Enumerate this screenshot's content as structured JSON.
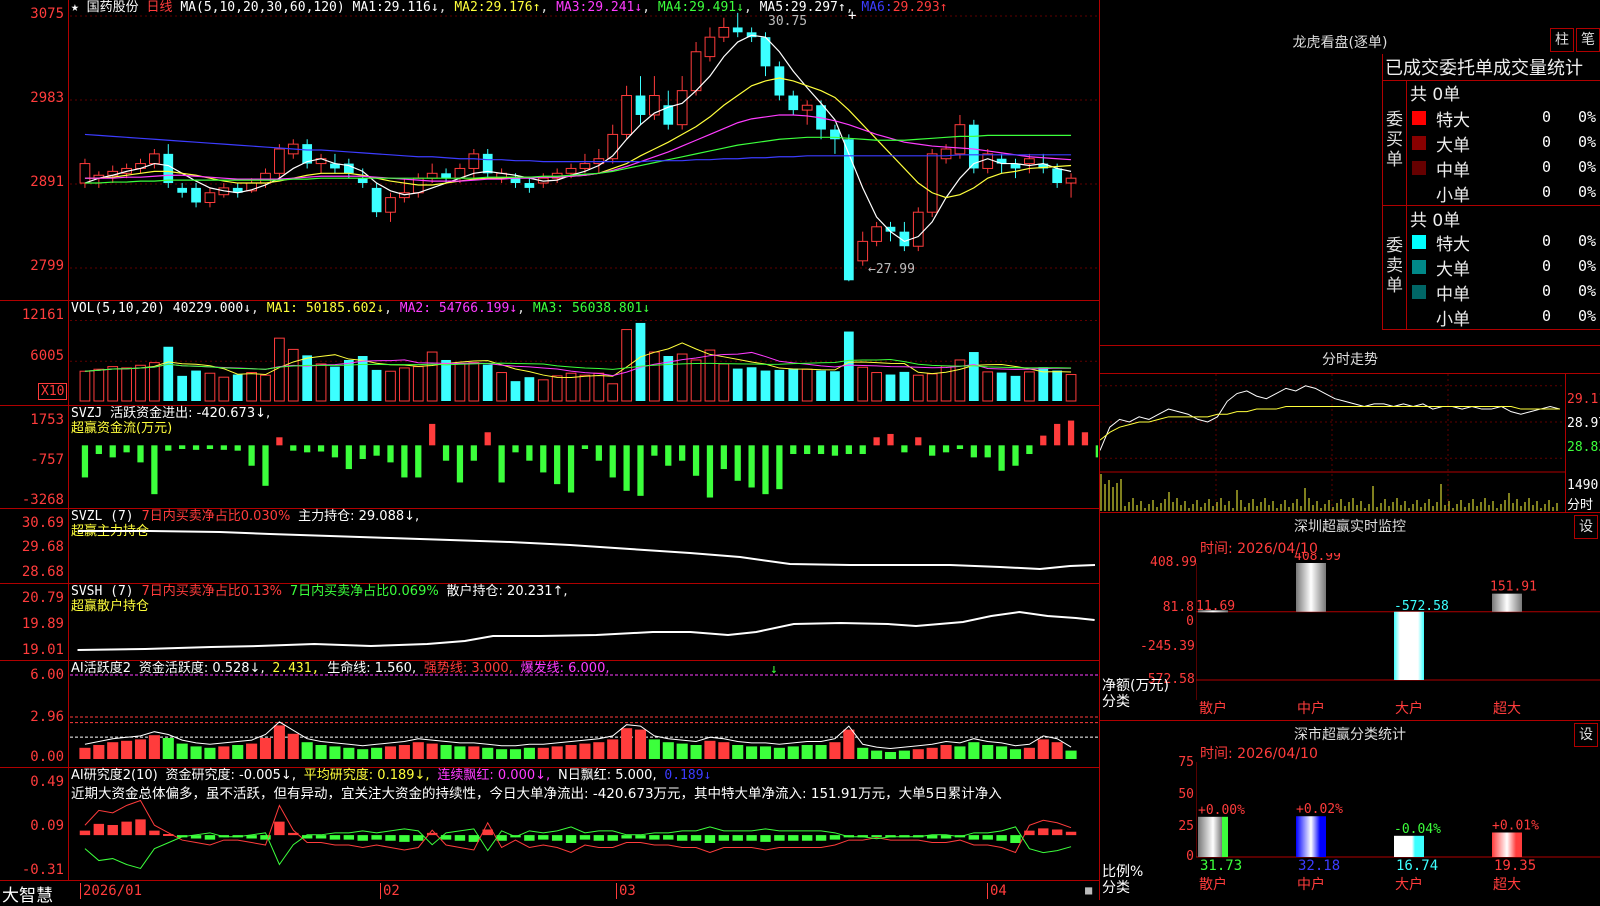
{
  "colors": {
    "up": "#ff3c3c",
    "down": "#3cffff",
    "ma1": "#ffffff",
    "ma2": "#ffff3c",
    "ma3": "#ff3cff",
    "ma4": "#3cff3c",
    "ma5": "#ff8080",
    "ma6": "#3c3cff",
    "border": "#b00000"
  },
  "kline": {
    "star": "★",
    "stock_name": "国药股份",
    "period": "日线",
    "ma_params": "MA(5,10,20,30,60,120)",
    "ma1_label": "MA1:",
    "ma1_val": "29.116↓",
    "ma2_label": "MA2:",
    "ma2_val": "29.176↑",
    "ma3_label": "MA3:",
    "ma3_val": "29.241↓",
    "ma4_label": "MA4:",
    "ma4_val": "29.491↓",
    "ma5_label": "MA5:",
    "ma5_val": "29.297↑",
    "ma6_label": "MA6:",
    "ma6_val": "29.293↑",
    "high_mark": "30.75",
    "low_mark": "←27.99",
    "y_ticks": [
      "3075",
      "2983",
      "2891",
      "2799"
    ],
    "y_min": 27.9,
    "y_max": 30.8,
    "dates": [
      "2026/01",
      "02",
      "03",
      "04"
    ]
  },
  "candles": [
    [
      29.0,
      29.2,
      28.95,
      29.25
    ],
    [
      29.05,
      29.08,
      28.95,
      29.12
    ],
    [
      29.08,
      29.12,
      29.0,
      29.18
    ],
    [
      29.1,
      29.15,
      29.05,
      29.2
    ],
    [
      29.15,
      29.2,
      29.1,
      29.25
    ],
    [
      29.2,
      29.3,
      29.15,
      29.35
    ],
    [
      29.3,
      29.0,
      28.95,
      29.4
    ],
    [
      28.95,
      28.9,
      28.85,
      29.0
    ],
    [
      28.95,
      28.8,
      28.75,
      29.0
    ],
    [
      28.8,
      28.9,
      28.75,
      28.95
    ],
    [
      28.88,
      28.95,
      28.85,
      29.0
    ],
    [
      28.95,
      28.9,
      28.85,
      29.0
    ],
    [
      28.92,
      29.0,
      28.9,
      29.05
    ],
    [
      29.0,
      29.1,
      28.95,
      29.15
    ],
    [
      29.1,
      29.35,
      29.05,
      29.4
    ],
    [
      29.3,
      29.4,
      29.25,
      29.45
    ],
    [
      29.4,
      29.2,
      29.15,
      29.45
    ],
    [
      29.2,
      29.25,
      29.1,
      29.3
    ],
    [
      29.2,
      29.15,
      29.1,
      29.3
    ],
    [
      29.2,
      29.1,
      29.05,
      29.25
    ],
    [
      29.05,
      29.0,
      28.95,
      29.15
    ],
    [
      28.95,
      28.7,
      28.65,
      29.0
    ],
    [
      28.7,
      28.85,
      28.6,
      28.9
    ],
    [
      28.85,
      28.9,
      28.8,
      29.05
    ],
    [
      28.9,
      29.05,
      28.85,
      29.1
    ],
    [
      29.05,
      29.1,
      29.0,
      29.2
    ],
    [
      29.1,
      29.05,
      29.0,
      29.15
    ],
    [
      29.05,
      29.15,
      29.0,
      29.2
    ],
    [
      29.15,
      29.3,
      29.05,
      29.35
    ],
    [
      29.3,
      29.1,
      29.05,
      29.35
    ],
    [
      29.05,
      29.1,
      29.0,
      29.15
    ],
    [
      29.05,
      29.0,
      28.95,
      29.1
    ],
    [
      29.0,
      28.95,
      28.9,
      29.05
    ],
    [
      29.0,
      29.05,
      28.95,
      29.1
    ],
    [
      29.05,
      29.1,
      29.0,
      29.15
    ],
    [
      29.1,
      29.15,
      29.05,
      29.2
    ],
    [
      29.15,
      29.2,
      29.1,
      29.3
    ],
    [
      29.2,
      29.25,
      29.1,
      29.35
    ],
    [
      29.25,
      29.5,
      29.2,
      29.6
    ],
    [
      29.5,
      29.9,
      29.45,
      30.0
    ],
    [
      29.9,
      29.7,
      29.6,
      30.1
    ],
    [
      29.7,
      29.9,
      29.65,
      30.1
    ],
    [
      29.8,
      29.6,
      29.55,
      29.95
    ],
    [
      29.6,
      29.95,
      29.55,
      30.1
    ],
    [
      29.95,
      30.35,
      29.9,
      30.45
    ],
    [
      30.3,
      30.5,
      30.25,
      30.6
    ],
    [
      30.5,
      30.6,
      30.45,
      30.7
    ],
    [
      30.6,
      30.55,
      30.5,
      30.75
    ],
    [
      30.55,
      30.5,
      30.45,
      30.6
    ],
    [
      30.5,
      30.2,
      30.1,
      30.55
    ],
    [
      30.2,
      29.9,
      29.85,
      30.25
    ],
    [
      29.9,
      29.75,
      29.7,
      29.95
    ],
    [
      29.75,
      29.8,
      29.6,
      29.85
    ],
    [
      29.8,
      29.55,
      29.45,
      29.85
    ],
    [
      29.55,
      29.45,
      29.3,
      29.6
    ],
    [
      29.45,
      28.0,
      27.99,
      29.5
    ],
    [
      28.2,
      28.4,
      28.15,
      28.5
    ],
    [
      28.4,
      28.55,
      28.35,
      28.6
    ],
    [
      28.55,
      28.5,
      28.4,
      28.6
    ],
    [
      28.5,
      28.35,
      28.3,
      28.6
    ],
    [
      28.35,
      28.7,
      28.3,
      28.75
    ],
    [
      28.7,
      29.3,
      28.65,
      29.35
    ],
    [
      29.25,
      29.35,
      29.2,
      29.4
    ],
    [
      29.3,
      29.6,
      29.25,
      29.7
    ],
    [
      29.6,
      29.15,
      29.1,
      29.65
    ],
    [
      29.15,
      29.3,
      29.1,
      29.35
    ],
    [
      29.25,
      29.2,
      29.1,
      29.3
    ],
    [
      29.2,
      29.15,
      29.05,
      29.25
    ],
    [
      29.2,
      29.25,
      29.1,
      29.3
    ],
    [
      29.2,
      29.15,
      29.1,
      29.3
    ],
    [
      29.15,
      29.0,
      28.95,
      29.2
    ],
    [
      29.0,
      29.05,
      28.85,
      29.1
    ]
  ],
  "ma_lines": {
    "ma1": [
      29.0,
      29.05,
      29.08,
      29.12,
      29.15,
      29.2,
      29.18,
      29.1,
      29.02,
      28.95,
      28.92,
      28.9,
      28.93,
      28.98,
      29.05,
      29.15,
      29.22,
      29.25,
      29.2,
      29.18,
      29.12,
      29.0,
      28.92,
      28.88,
      28.9,
      28.95,
      29.0,
      29.05,
      29.1,
      29.12,
      29.1,
      29.08,
      29.05,
      29.02,
      29.03,
      29.08,
      29.12,
      29.18,
      29.28,
      29.45,
      29.6,
      29.72,
      29.78,
      29.82,
      29.95,
      30.1,
      30.3,
      30.45,
      30.52,
      30.5,
      30.35,
      30.15,
      29.98,
      29.82,
      29.65,
      29.3,
      28.95,
      28.65,
      28.5,
      28.4,
      28.45,
      28.6,
      28.85,
      29.05,
      29.2,
      29.25,
      29.2,
      29.2,
      29.18,
      29.2,
      29.15,
      29.12
    ],
    "ma2": [
      29.05,
      29.05,
      29.06,
      29.08,
      29.1,
      29.12,
      29.12,
      29.1,
      29.08,
      29.05,
      29.02,
      29.0,
      29.0,
      29.0,
      29.02,
      29.05,
      29.08,
      29.1,
      29.1,
      29.1,
      29.08,
      29.05,
      29.02,
      29.0,
      28.98,
      28.98,
      29.0,
      29.02,
      29.04,
      29.05,
      29.05,
      29.06,
      29.06,
      29.06,
      29.06,
      29.07,
      29.08,
      29.1,
      29.15,
      29.2,
      29.28,
      29.35,
      29.42,
      29.5,
      29.58,
      29.68,
      29.8,
      29.9,
      30.0,
      30.05,
      30.08,
      30.05,
      30.0,
      29.95,
      29.88,
      29.75,
      29.6,
      29.45,
      29.3,
      29.15,
      29.0,
      28.9,
      28.85,
      28.88,
      28.95,
      29.05,
      29.1,
      29.12,
      29.15,
      29.16,
      29.17,
      29.18
    ],
    "ma3": [
      29.05,
      29.05,
      29.05,
      29.06,
      29.06,
      29.07,
      29.08,
      29.08,
      29.07,
      29.06,
      29.05,
      29.04,
      29.04,
      29.04,
      29.04,
      29.05,
      29.06,
      29.07,
      29.07,
      29.07,
      29.07,
      29.06,
      29.05,
      29.04,
      29.03,
      29.02,
      29.02,
      29.02,
      29.03,
      29.04,
      29.04,
      29.05,
      29.05,
      29.06,
      29.06,
      29.07,
      29.08,
      29.1,
      29.13,
      29.17,
      29.22,
      29.27,
      29.32,
      29.38,
      29.44,
      29.5,
      29.56,
      29.62,
      29.66,
      29.68,
      29.7,
      29.7,
      29.69,
      29.67,
      29.64,
      29.6,
      29.55,
      29.5,
      29.46,
      29.42,
      29.4,
      29.38,
      29.37,
      29.36,
      29.35,
      29.33,
      29.31,
      29.29,
      29.27,
      29.26,
      29.25,
      29.24
    ],
    "ma4": [
      29.0,
      29.0,
      29.01,
      29.01,
      29.02,
      29.02,
      29.03,
      29.03,
      29.03,
      29.03,
      29.03,
      29.03,
      29.03,
      29.03,
      29.03,
      29.04,
      29.04,
      29.05,
      29.05,
      29.05,
      29.05,
      29.05,
      29.05,
      29.05,
      29.05,
      29.05,
      29.05,
      29.05,
      29.05,
      29.06,
      29.06,
      29.06,
      29.06,
      29.07,
      29.07,
      29.08,
      29.09,
      29.1,
      29.12,
      29.15,
      29.18,
      29.21,
      29.24,
      29.27,
      29.3,
      29.33,
      29.36,
      29.39,
      29.41,
      29.43,
      29.45,
      29.46,
      29.47,
      29.47,
      29.47,
      29.46,
      29.45,
      29.44,
      29.44,
      29.44,
      29.45,
      29.46,
      29.47,
      29.48,
      29.48,
      29.49,
      29.49,
      29.49,
      29.49,
      29.49,
      29.49,
      29.49
    ],
    "ma6": [
      29.5,
      29.49,
      29.48,
      29.47,
      29.46,
      29.45,
      29.44,
      29.43,
      29.42,
      29.41,
      29.4,
      29.39,
      29.38,
      29.37,
      29.36,
      29.35,
      29.34,
      29.34,
      29.33,
      29.32,
      29.31,
      29.3,
      29.29,
      29.28,
      29.27,
      29.27,
      29.26,
      29.25,
      29.25,
      29.24,
      29.24,
      29.23,
      29.23,
      29.22,
      29.22,
      29.22,
      29.22,
      29.22,
      29.22,
      29.22,
      29.22,
      29.23,
      29.23,
      29.23,
      29.24,
      29.24,
      29.25,
      29.25,
      29.26,
      29.26,
      29.27,
      29.27,
      29.28,
      29.28,
      29.28,
      29.28,
      29.28,
      29.28,
      29.28,
      29.28,
      29.28,
      29.28,
      29.28,
      29.29,
      29.29,
      29.29,
      29.29,
      29.29,
      29.29,
      29.29,
      29.29,
      29.29
    ]
  },
  "vol": {
    "label": "VOL(5,10,20)",
    "value": "40229.000↓",
    "ma1": "MA1: 50185.602↓",
    "ma2": "MA2: 54766.199↓",
    "ma3": "MA3: 56038.801↓",
    "y_ticks": [
      "12161",
      "6005"
    ],
    "unit": "X10",
    "y_max": 13000,
    "bars": [
      4500,
      4800,
      5200,
      5000,
      5400,
      5800,
      8200,
      3800,
      4600,
      4200,
      3600,
      4000,
      4300,
      3900,
      9500,
      7800,
      6900,
      5600,
      5200,
      6200,
      6800,
      4700,
      4500,
      5000,
      5200,
      7400,
      6200,
      5600,
      5800,
      5500,
      4300,
      3000,
      3600,
      3200,
      3800,
      4200,
      3900,
      4200,
      2600,
      10800,
      11800,
      7400,
      6800,
      7100,
      6200,
      7700,
      5600,
      4900,
      5100,
      4600,
      4700,
      4900,
      4800,
      4600,
      4500,
      10500,
      5100,
      4300,
      4000,
      4400,
      3900,
      4100,
      5300,
      6200,
      7400,
      4400,
      4300,
      3800,
      4400,
      5100,
      4600,
      4000
    ]
  },
  "svzj": {
    "label": "SVZJ",
    "desc": "活跃资金进出: -420.673↓,",
    "sub": "超赢资金流(万元)",
    "y_ticks": [
      "1753",
      "-757",
      "-3268"
    ],
    "vals": [
      -1800,
      -400,
      -600,
      -300,
      -900,
      -2800,
      -200,
      -100,
      -150,
      -100,
      -150,
      -200,
      -1100,
      -2300,
      600,
      -200,
      -300,
      -250,
      -600,
      -1300,
      -700,
      -500,
      -900,
      -1800,
      -1800,
      1400,
      -800,
      -2100,
      -800,
      900,
      -2100,
      -300,
      -800,
      -1500,
      -2200,
      -2700,
      -100,
      -800,
      -1800,
      -2600,
      -2900,
      -500,
      -1100,
      -800,
      -1700,
      -3000,
      -1300,
      -2000,
      -2400,
      -2800,
      -2500,
      -400,
      -400,
      -400,
      -500,
      -400,
      -400,
      600,
      800,
      -300,
      600,
      -500,
      -300,
      -100,
      -600,
      -600,
      -1400,
      -1100,
      -400,
      700,
      1400,
      1600,
      900,
      -600
    ]
  },
  "svzl": {
    "label": "SVZL (7)",
    "p1": "7日内买卖净占比0.030%",
    "p2": "主力持仓: 29.088↓,",
    "sub": "超赢主力持仓",
    "y_ticks": [
      "30.69",
      "29.68",
      "28.68"
    ]
  },
  "svsh": {
    "label": "SVSH (7)",
    "p1": "7日内买卖净占比0.13%",
    "p2": "7日内买卖净占比0.069%",
    "p3": "散户持仓: 20.231↑,",
    "sub": "超赢散户持仓",
    "y_ticks": [
      "20.79",
      "19.89",
      "19.01"
    ]
  },
  "ai1": {
    "label": "AI活跃度2",
    "p1": "资金活跃度: 0.528↓,",
    "p2": "2.431,",
    "p3": "生命线: 1.560,",
    "p4": "强势线: 3.000,",
    "p5": "爆发线: 6.000,",
    "y_ticks": [
      "6.00",
      "2.96",
      "0.00"
    ],
    "vals": [
      0.8,
      1.0,
      1.2,
      1.3,
      1.4,
      1.7,
      1.5,
      1.1,
      0.9,
      0.8,
      0.9,
      1.0,
      1.1,
      1.5,
      2.4,
      1.8,
      1.2,
      1.0,
      0.9,
      0.8,
      0.7,
      0.8,
      0.9,
      1.0,
      1.2,
      1.1,
      1.0,
      0.9,
      0.9,
      0.8,
      0.7,
      0.7,
      0.8,
      0.8,
      0.9,
      1.0,
      1.1,
      1.2,
      1.4,
      2.2,
      2.1,
      1.4,
      1.2,
      1.1,
      1.0,
      1.3,
      1.2,
      1.0,
      0.9,
      0.9,
      0.8,
      0.9,
      1.0,
      1.0,
      1.2,
      2.1,
      0.8,
      0.6,
      0.5,
      0.6,
      0.7,
      0.8,
      1.0,
      0.9,
      1.2,
      1.0,
      0.9,
      0.7,
      0.8,
      1.4,
      1.2,
      0.6
    ],
    "up": [
      1,
      1,
      1,
      1,
      1,
      1,
      0,
      0,
      0,
      0,
      1,
      0,
      1,
      1,
      1,
      1,
      0,
      0,
      0,
      0,
      0,
      0,
      1,
      1,
      1,
      1,
      0,
      0,
      1,
      0,
      0,
      0,
      0,
      1,
      1,
      1,
      1,
      1,
      1,
      1,
      1,
      0,
      0,
      0,
      0,
      1,
      1,
      0,
      0,
      0,
      0,
      0,
      0,
      0,
      1,
      1,
      0,
      0,
      0,
      0,
      1,
      1,
      1,
      0,
      0,
      0,
      0,
      0,
      1,
      1,
      1,
      0
    ]
  },
  "ai2": {
    "label": "AI研究度2(10)",
    "p1": "资金研究度: -0.005↓,",
    "p2": "平均研究度: 0.189↓,",
    "p3": "连续飘红: 0.000↓,",
    "p4": "N日飘红: 5.000,",
    "p5": "0.189↓",
    "y_ticks": [
      "0.49",
      "0.09",
      "-0.31"
    ],
    "text": "近期大资金总体偏多，虽不活跃，但有异动，宜关注大资金的持续性，今日大单净流出: -420.673万元，其中特大单净流入: 151.91万元，大单5日累计净入",
    "vals": [
      0.04,
      0.1,
      0.09,
      0.12,
      0.14,
      0.04,
      0.01,
      -0.02,
      -0.03,
      -0.04,
      -0.02,
      -0.02,
      -0.03,
      -0.04,
      0.12,
      0.02,
      -0.03,
      -0.03,
      -0.04,
      -0.04,
      -0.05,
      -0.04,
      -0.05,
      -0.06,
      -0.05,
      0.02,
      -0.04,
      -0.05,
      -0.06,
      0.05,
      -0.05,
      -0.02,
      -0.05,
      -0.04,
      -0.05,
      -0.07,
      -0.04,
      -0.05,
      -0.05,
      -0.03,
      -0.03,
      -0.04,
      -0.04,
      -0.05,
      -0.05,
      -0.07,
      -0.05,
      -0.05,
      -0.05,
      -0.06,
      -0.05,
      -0.05,
      -0.05,
      -0.05,
      -0.04,
      -0.02,
      -0.02,
      -0.01,
      -0.02,
      -0.02,
      -0.02,
      -0.03,
      -0.03,
      -0.02,
      -0.04,
      -0.04,
      -0.05,
      -0.07,
      0.04,
      0.06,
      0.05,
      0.03
    ]
  },
  "bottom_brand": "大智慧",
  "dragon": {
    "title": "龙虎看盘(逐单)",
    "btn_bar": "柱",
    "btn_pen": "笔",
    "stats_title": "已成交委托单成交量统计",
    "buy_side": "委买单",
    "sell_side": "委卖单",
    "buy_total": "共 0单",
    "sell_total": "共 0单",
    "buy_rows": [
      {
        "name": "特大",
        "v": "0",
        "p": "0%",
        "c": "#ff0000"
      },
      {
        "name": "大单",
        "v": "0",
        "p": "0%",
        "c": "#880000"
      },
      {
        "name": "中单",
        "v": "0",
        "p": "0%",
        "c": "#660000"
      },
      {
        "name": "小单",
        "v": "0",
        "p": "0%",
        "c": ""
      }
    ],
    "sell_rows": [
      {
        "name": "特大",
        "v": "0",
        "p": "0%",
        "c": "#00ffff"
      },
      {
        "name": "大单",
        "v": "0",
        "p": "0%",
        "c": "#008888"
      },
      {
        "name": "中单",
        "v": "0",
        "p": "0%",
        "c": "#006666"
      },
      {
        "name": "小单",
        "v": "0",
        "p": "0%",
        "c": ""
      }
    ]
  },
  "intraday": {
    "title": "分时走势",
    "y_ticks": [
      "29.11",
      "28.97",
      "28.83"
    ],
    "vol_tick": "1490",
    "vol_unit": "分时",
    "price": [
      28.86,
      28.95,
      28.98,
      28.97,
      28.99,
      28.98,
      29.0,
      29.02,
      29.01,
      29.0,
      28.98,
      28.97,
      28.99,
      29.05,
      29.08,
      29.09,
      29.07,
      29.06,
      29.08,
      29.1,
      29.09,
      29.11,
      29.1,
      29.08,
      29.06,
      29.05,
      29.04,
      29.03,
      29.04,
      29.04,
      29.03,
      29.04,
      29.03,
      29.04,
      29.02,
      29.03,
      29.03,
      29.02,
      29.03,
      29.02,
      29.02,
      29.03,
      29.01,
      29.0,
      29.01,
      29.02,
      29.03,
      29.02
    ],
    "avg": [
      28.9,
      28.93,
      28.95,
      28.96,
      28.97,
      28.97,
      28.98,
      28.99,
      28.99,
      28.99,
      28.99,
      28.99,
      29.0,
      29.0,
      29.01,
      29.01,
      29.02,
      29.02,
      29.02,
      29.03,
      29.03,
      29.03,
      29.03,
      29.03,
      29.03,
      29.03,
      29.03,
      29.03,
      29.03,
      29.03,
      29.03,
      29.03,
      29.03,
      29.03,
      29.03,
      29.03,
      29.03,
      29.03,
      29.03,
      29.03,
      29.03,
      29.03,
      29.03,
      29.02,
      29.02,
      29.02,
      29.02,
      29.02
    ]
  },
  "sz_monitor": {
    "title": "深圳超赢实时监控",
    "btn": "设",
    "time": "时间: 2026/04/10",
    "y_ticks": [
      "408.99",
      "81.8",
      "0",
      "-245.39",
      "-572.58"
    ],
    "unit": "净额(万元)",
    "cat_label": "分类",
    "cats": [
      "散户",
      "中户",
      "大户",
      "超大"
    ],
    "vals": [
      11.69,
      408.99,
      -572.58,
      151.91
    ],
    "labels": [
      "11.69",
      "408.99",
      "-572.58",
      "151.91"
    ]
  },
  "sz_class": {
    "title": "深市超赢分类统计",
    "btn": "设",
    "time": "时间: 2026/04/10",
    "y_ticks": [
      "75",
      "50",
      "25",
      "0"
    ],
    "unit": "比例%",
    "cat_label": "分类",
    "cats": [
      "散户",
      "中户",
      "大户",
      "超大"
    ],
    "vals": [
      31.73,
      32.18,
      16.74,
      19.35
    ],
    "deltas": [
      "+0.00%",
      "+0.02%",
      "-0.04%",
      "+0.01%"
    ],
    "labels": [
      "31.73",
      "32.18",
      "16.74",
      "19.35"
    ]
  }
}
